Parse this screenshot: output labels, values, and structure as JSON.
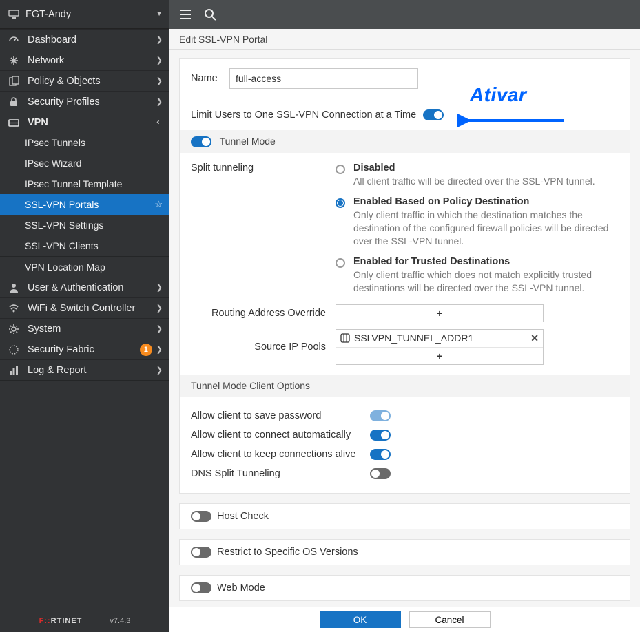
{
  "header": {
    "device_name": "FGT-Andy"
  },
  "sidebar": {
    "items": [
      {
        "label": "Dashboard"
      },
      {
        "label": "Network"
      },
      {
        "label": "Policy & Objects"
      },
      {
        "label": "Security Profiles"
      },
      {
        "label": "VPN"
      },
      {
        "label": "User & Authentication"
      },
      {
        "label": "WiFi & Switch Controller"
      },
      {
        "label": "System"
      },
      {
        "label": "Security Fabric",
        "badge": "1"
      },
      {
        "label": "Log & Report"
      }
    ],
    "vpn_children": [
      {
        "label": "IPsec Tunnels"
      },
      {
        "label": "IPsec Wizard"
      },
      {
        "label": "IPsec Tunnel Template"
      },
      {
        "label": "SSL-VPN Portals"
      },
      {
        "label": "SSL-VPN Settings"
      },
      {
        "label": "SSL-VPN Clients"
      },
      {
        "label": "VPN Location Map"
      }
    ],
    "brand_left": "F",
    "brand_rest": "RTINET",
    "version": "v7.4.3"
  },
  "crumb": "Edit SSL-VPN Portal",
  "form": {
    "name_label": "Name",
    "name_value": "full-access",
    "limit_label": "Limit Users to One SSL-VPN Connection at a Time",
    "tunnel_mode_label": "Tunnel Mode",
    "split_label": "Split tunneling",
    "opts": [
      {
        "title": "Disabled",
        "desc": "All client traffic will be directed over the SSL-VPN tunnel."
      },
      {
        "title": "Enabled Based on Policy Destination",
        "desc": "Only client traffic in which the destination matches the destination of the configured firewall policies will be directed over the SSL-VPN tunnel."
      },
      {
        "title": "Enabled for Trusted Destinations",
        "desc": "Only client traffic which does not match explicitly trusted destinations will be directed over the SSL-VPN tunnel."
      }
    ],
    "routing_label": "Routing Address Override",
    "source_label": "Source IP Pools",
    "source_value": "SSLVPN_TUNNEL_ADDR1",
    "plus": "+",
    "client_opts_header": "Tunnel Mode Client Options",
    "client_opts": [
      {
        "label": "Allow client to save password"
      },
      {
        "label": "Allow client to connect automatically"
      },
      {
        "label": "Allow client to keep connections alive"
      },
      {
        "label": "DNS Split Tunneling"
      }
    ],
    "sections": [
      {
        "label": "Host Check"
      },
      {
        "label": "Restrict to Specific OS Versions"
      },
      {
        "label": "Web Mode"
      }
    ]
  },
  "footer": {
    "ok": "OK",
    "cancel": "Cancel"
  },
  "annotation": {
    "text": "Ativar"
  }
}
